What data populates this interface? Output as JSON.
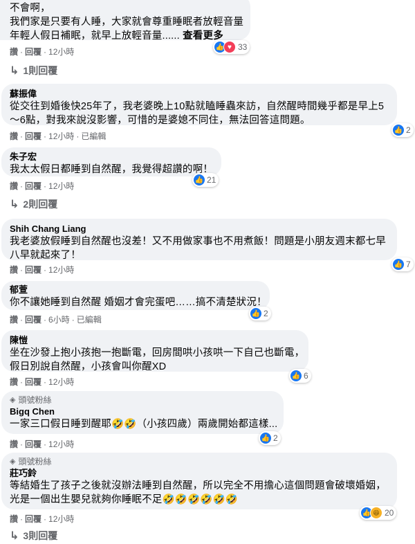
{
  "comments": [
    {
      "name": "",
      "lines": [
        "不會啊，",
        "我們家是只要有人睡，大家就會尊重睡眠者放輕音量",
        "年輕人假日補眠，就早上放輕音量......"
      ],
      "more": "查看更多",
      "actions": {
        "like": "讚",
        "reply": "回覆",
        "time": "12小時",
        "edited": ""
      },
      "reactions": {
        "icons": [
          "like",
          "love"
        ],
        "count": "33"
      },
      "replies": "1則回覆"
    },
    {
      "name": "蘇振偉",
      "lines": [
        "從交往到婚後快25年了，我老婆晚上10點就瞌睡蟲來訪，自然醒時間幾乎都是早上5",
        "～6點，對我來說沒影響，可惜的是婆媳不同住，無法回答這問題。"
      ],
      "actions": {
        "like": "讚",
        "reply": "回覆",
        "time": "12小時",
        "edited": "已編輯"
      },
      "reactions": {
        "icons": [
          "like"
        ],
        "count": "2"
      }
    },
    {
      "name": "朱子宏",
      "lines": [
        "我太太假日都睡到自然醒，我覺得超讚的啊！"
      ],
      "actions": {
        "like": "讚",
        "reply": "回覆",
        "time": "12小時",
        "edited": ""
      },
      "reactions": {
        "icons": [
          "like"
        ],
        "count": "21"
      },
      "replies": "2則回覆"
    },
    {
      "name": "Shih Chang Liang",
      "lines": [
        "我老婆放假睡到自然醒也沒差！又不用做家事也不用煮飯！問題是小朋友週末都七早",
        "八早就起來了！"
      ],
      "actions": {
        "like": "讚",
        "reply": "回覆",
        "time": "12小時",
        "edited": ""
      },
      "reactions": {
        "icons": [
          "like"
        ],
        "count": "7"
      }
    },
    {
      "name": "郁萱",
      "lines": [
        "你不讓她睡到自然醒 婚姻才會完蛋吧……搞不清楚狀況！"
      ],
      "actions": {
        "like": "讚",
        "reply": "回覆",
        "time": "6小時",
        "edited": "已編輯"
      },
      "reactions": {
        "icons": [
          "like"
        ],
        "count": "2"
      }
    },
    {
      "name": "陳愷",
      "lines": [
        "坐在沙發上抱小孩抱一抱斷電，回房間哄小孩哄一下自己也斷電，",
        "假日別說自然醒，小孩會叫你醒XD"
      ],
      "actions": {
        "like": "讚",
        "reply": "回覆",
        "time": "12小時",
        "edited": ""
      },
      "reactions": {
        "icons": [
          "like"
        ],
        "count": "6"
      }
    },
    {
      "badge": "頭號粉絲",
      "name": "Bigq Chen",
      "lines": [
        "一家三口假日睡到醒耶🤣🤣（小孩四歲）兩歲開始都這樣..."
      ],
      "actions": {
        "like": "讚",
        "reply": "回覆",
        "time": "12小時",
        "edited": ""
      },
      "reactions": {
        "icons": [
          "like"
        ],
        "count": "2"
      }
    },
    {
      "badge": "頭號粉絲",
      "name": "莊巧鈴",
      "lines": [
        "等結婚生了孩子之後就沒辦法睡到自然醒，所以完全不用擔心這個問題會破壞婚姻，",
        "光是一個出生嬰兒就夠你睡眠不足🤣🤣🤣🤣🤣🤣"
      ],
      "actions": {
        "like": "讚",
        "reply": "回覆",
        "time": "12小時",
        "edited": ""
      },
      "reactions": {
        "icons": [
          "like",
          "haha"
        ],
        "count": "20"
      },
      "replies": "3則回覆"
    }
  ]
}
